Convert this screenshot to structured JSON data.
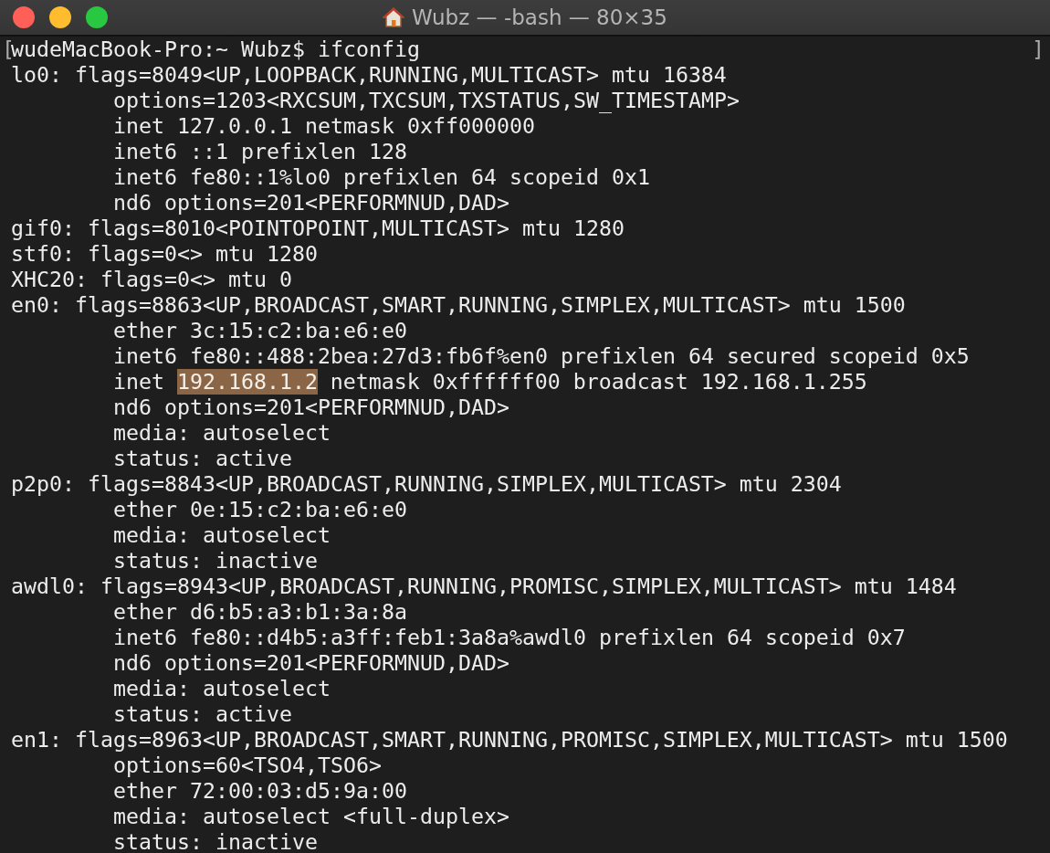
{
  "window": {
    "title": "Wubz — -bash — 80×35"
  },
  "terminal": {
    "prompt": {
      "mark_left": "[",
      "text": "wudeMacBook-Pro:~ Wubz$ ifconfig",
      "mark_right": "]"
    },
    "interfaces": [
      {
        "text": "lo0: flags=8049<UP,LOOPBACK,RUNNING,MULTICAST> mtu 16384",
        "children": [
          {
            "text": "options=1203<RXCSUM,TXCSUM,TXSTATUS,SW_TIMESTAMP>"
          },
          {
            "text": "inet 127.0.0.1 netmask 0xff000000"
          },
          {
            "text": "inet6 ::1 prefixlen 128"
          },
          {
            "text": "inet6 fe80::1%lo0 prefixlen 64 scopeid 0x1"
          },
          {
            "text": "nd6 options=201<PERFORMNUD,DAD>"
          }
        ]
      },
      {
        "text": "gif0: flags=8010<POINTOPOINT,MULTICAST> mtu 1280"
      },
      {
        "text": "stf0: flags=0<> mtu 1280"
      },
      {
        "text": "XHC20: flags=0<> mtu 0"
      },
      {
        "text": "en0: flags=8863<UP,BROADCAST,SMART,RUNNING,SIMPLEX,MULTICAST> mtu 1500",
        "children": [
          {
            "text": "ether 3c:15:c2:ba:e6:e0"
          },
          {
            "text": "inet6 fe80::488:2bea:27d3:fb6f%en0 prefixlen 64 secured scopeid 0x5"
          },
          {
            "parts": [
              {
                "text": "inet",
                "selected": false
              },
              {
                "text": "192.168.1.2",
                "selected": true
              },
              {
                "text": "netmask 0xffffff00 broadcast 192.168.1.255",
                "selected": false
              }
            ]
          },
          {
            "text": "nd6 options=201<PERFORMNUD,DAD>"
          },
          {
            "text": "media: autoselect"
          },
          {
            "text": "status: active"
          }
        ]
      },
      {
        "text": "p2p0: flags=8843<UP,BROADCAST,RUNNING,SIMPLEX,MULTICAST> mtu 2304",
        "children": [
          {
            "text": "ether 0e:15:c2:ba:e6:e0"
          },
          {
            "text": "media: autoselect"
          },
          {
            "text": "status: inactive"
          }
        ]
      },
      {
        "text": "awdl0: flags=8943<UP,BROADCAST,RUNNING,PROMISC,SIMPLEX,MULTICAST> mtu 1484",
        "children": [
          {
            "text": "ether d6:b5:a3:b1:3a:8a"
          },
          {
            "text": "inet6 fe80::d4b5:a3ff:feb1:3a8a%awdl0 prefixlen 64 scopeid 0x7"
          },
          {
            "text": "nd6 options=201<PERFORMNUD,DAD>"
          },
          {
            "text": "media: autoselect"
          },
          {
            "text": "status: active"
          }
        ]
      },
      {
        "text": "en1: flags=8963<UP,BROADCAST,SMART,RUNNING,PROMISC,SIMPLEX,MULTICAST> mtu 1500",
        "children": [
          {
            "text": "options=60<TSO4,TSO6>"
          },
          {
            "text": "ether 72:00:03:d5:9a:00"
          },
          {
            "text": "media: autoselect <full-duplex>"
          },
          {
            "text": "status: inactive"
          }
        ]
      }
    ]
  }
}
